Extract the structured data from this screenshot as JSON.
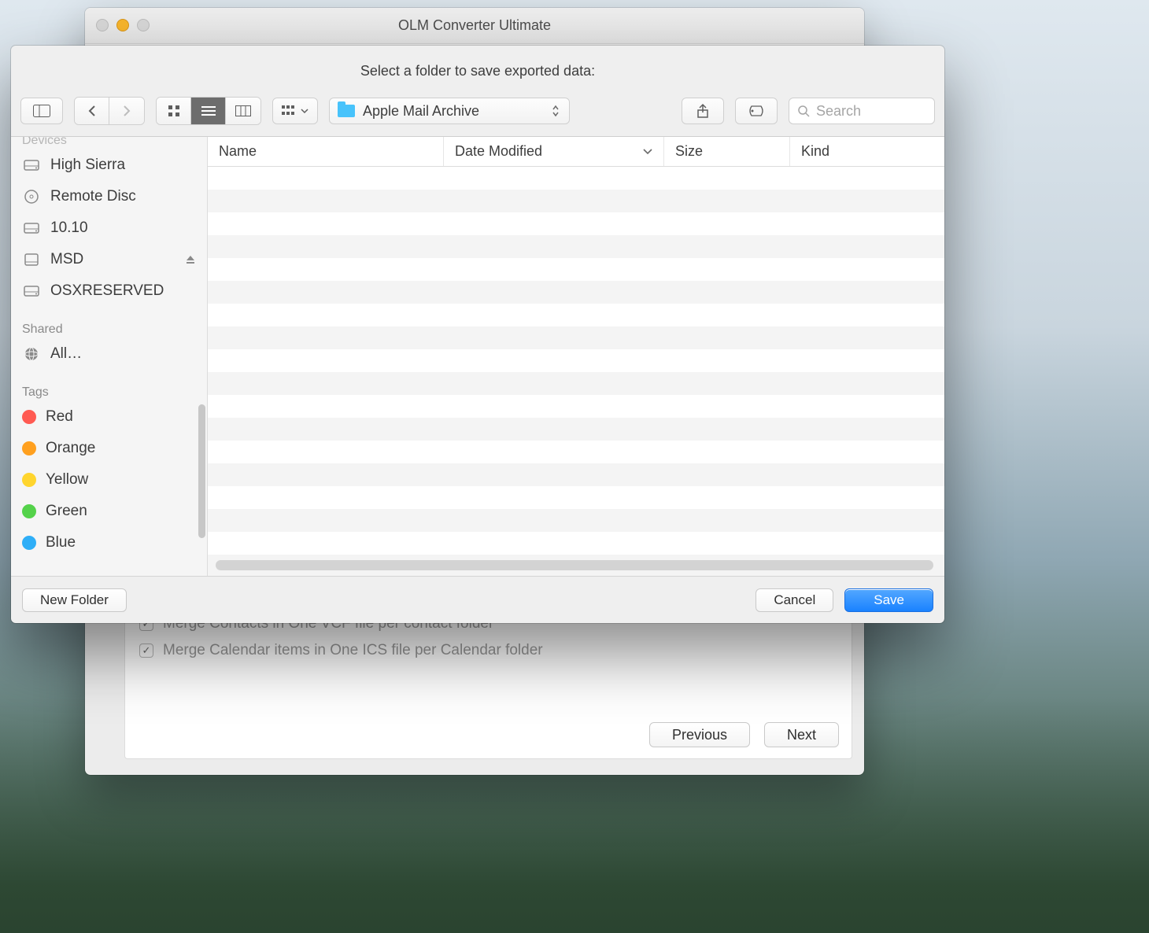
{
  "main_window": {
    "title": "OLM Converter Ultimate",
    "options": [
      {
        "label": "Merge Contacts in One VCF file per contact folder"
      },
      {
        "label": "Merge Calendar items in One ICS file per Calendar folder"
      }
    ],
    "buttons": {
      "previous": "Previous",
      "next": "Next"
    }
  },
  "sheet": {
    "heading": "Select a folder to save exported data:",
    "path": "Apple Mail Archive",
    "search_placeholder": "Search",
    "columns": {
      "name": "Name",
      "date": "Date Modified",
      "size": "Size",
      "kind": "Kind"
    },
    "footer": {
      "new_folder": "New Folder",
      "cancel": "Cancel",
      "save": "Save"
    },
    "sidebar": {
      "devices_label": "Devices",
      "shared_label": "Shared",
      "tags_label": "Tags",
      "devices": [
        {
          "label": "High Sierra",
          "icon": "internal-disk"
        },
        {
          "label": "Remote Disc",
          "icon": "optical-disc"
        },
        {
          "label": "10.10",
          "icon": "internal-disk"
        },
        {
          "label": "MSD",
          "icon": "external-disk",
          "eject": true
        },
        {
          "label": "OSXRESERVED",
          "icon": "internal-disk"
        }
      ],
      "shared": [
        {
          "label": "All…",
          "icon": "network"
        }
      ],
      "tags": [
        {
          "label": "Red",
          "color": "#ff5a52"
        },
        {
          "label": "Orange",
          "color": "#ffa01f"
        },
        {
          "label": "Yellow",
          "color": "#ffd52e"
        },
        {
          "label": "Green",
          "color": "#54d24a"
        },
        {
          "label": "Blue",
          "color": "#2eaef7"
        }
      ]
    }
  }
}
